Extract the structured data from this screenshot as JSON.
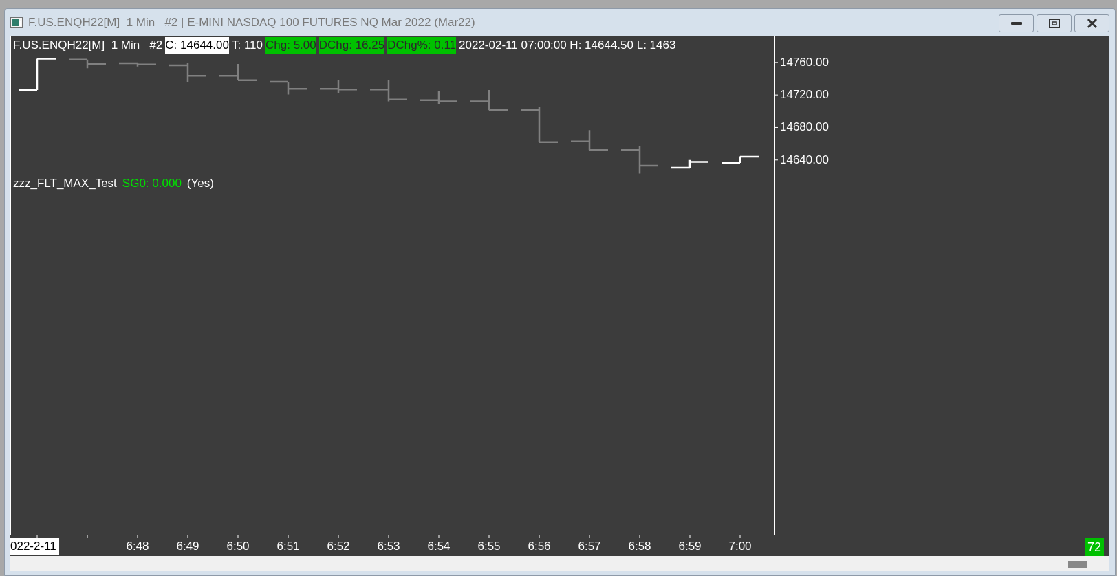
{
  "window": {
    "title": "F.US.ENQH22[M]  1 Min   #2 | E-MINI NASDAQ 100 FUTURES NQ Mar 2022 (Mar22)"
  },
  "header": [
    {
      "text": "F.US.ENQH22[M]  1 Min   #2",
      "kind": "plain"
    },
    {
      "text": "C: 14644.00",
      "kind": "inverse"
    },
    {
      "text": "T: 110",
      "kind": "plain"
    },
    {
      "text": "Chg: 5.00",
      "kind": "up"
    },
    {
      "text": "DChg: 16.25",
      "kind": "up"
    },
    {
      "text": "DChg%: 0.11",
      "kind": "up"
    },
    {
      "text": "2022-02-11 07:00:00 H: 14644.50 L: 1463",
      "kind": "plain"
    }
  ],
  "study": [
    {
      "text": "zzz_FLT_MAX_Test",
      "kind": "name"
    },
    {
      "text": "SG0: 0.000",
      "kind": "value",
      "color": "#00e000"
    },
    {
      "text": "(Yes)",
      "kind": "name"
    }
  ],
  "price_axis": [
    "14760.00",
    "14720.00",
    "14680.00",
    "14640.00"
  ],
  "date_label": "022-2-11",
  "time_axis": [
    "6:48",
    "6:49",
    "6:50",
    "6:51",
    "6:52",
    "6:53",
    "6:54",
    "6:55",
    "6:56",
    "6:57",
    "6:58",
    "6:59",
    "7:00"
  ],
  "bar_count": "72"
}
